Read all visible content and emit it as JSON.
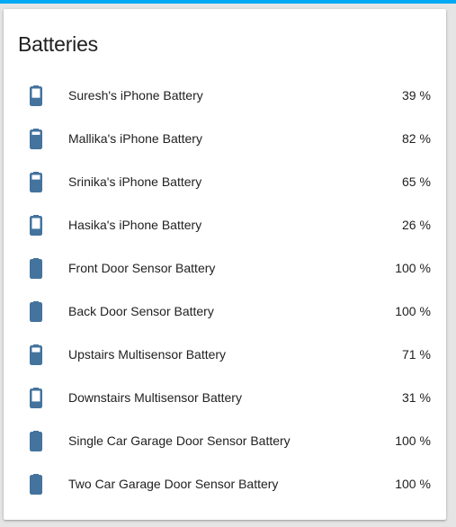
{
  "card": {
    "title": "Batteries"
  },
  "colors": {
    "icon": "#44739e",
    "topbar": "#03a9f4",
    "text": "#212121"
  },
  "batteries": [
    {
      "name": "Suresh's iPhone Battery",
      "value": "39",
      "unit": "%",
      "icon": "battery-40-icon",
      "level": 0.39
    },
    {
      "name": "Mallika's iPhone Battery",
      "value": "82",
      "unit": "%",
      "icon": "battery-80-icon",
      "level": 0.82
    },
    {
      "name": "Srinika's iPhone Battery",
      "value": "65",
      "unit": "%",
      "icon": "battery-60-icon",
      "level": 0.65
    },
    {
      "name": "Hasika's iPhone Battery",
      "value": "26",
      "unit": "%",
      "icon": "battery-20-icon",
      "level": 0.26
    },
    {
      "name": "Front Door Sensor Battery",
      "value": "100",
      "unit": "%",
      "icon": "battery-full-icon",
      "level": 1.0
    },
    {
      "name": "Back Door Sensor Battery",
      "value": "100",
      "unit": "%",
      "icon": "battery-full-icon",
      "level": 1.0
    },
    {
      "name": "Upstairs Multisensor Battery",
      "value": "71",
      "unit": "%",
      "icon": "battery-70-icon",
      "level": 0.71
    },
    {
      "name": "Downstairs Multisensor Battery",
      "value": "31",
      "unit": "%",
      "icon": "battery-30-icon",
      "level": 0.31
    },
    {
      "name": "Single Car Garage Door Sensor Battery",
      "value": "100",
      "unit": "%",
      "icon": "battery-full-icon",
      "level": 1.0
    },
    {
      "name": "Two Car Garage Door Sensor Battery",
      "value": "100",
      "unit": "%",
      "icon": "battery-full-icon",
      "level": 1.0
    }
  ]
}
